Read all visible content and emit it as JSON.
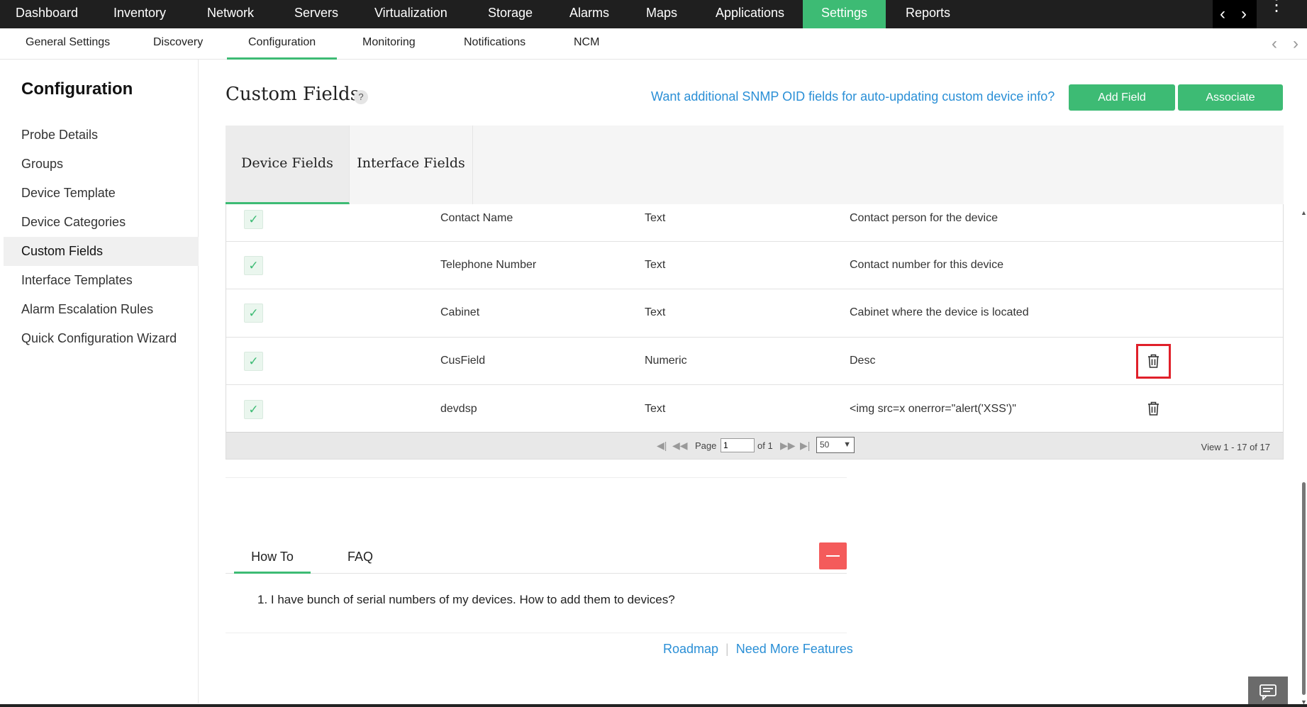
{
  "topnav": {
    "items": [
      {
        "label": "Dashboard"
      },
      {
        "label": "Inventory"
      },
      {
        "label": "Network"
      },
      {
        "label": "Servers"
      },
      {
        "label": "Virtualization"
      },
      {
        "label": "Storage"
      },
      {
        "label": "Alarms"
      },
      {
        "label": "Maps"
      },
      {
        "label": "Applications"
      },
      {
        "label": "Settings",
        "active": true
      },
      {
        "label": "Reports"
      }
    ]
  },
  "subnav": {
    "items": [
      {
        "label": "General Settings"
      },
      {
        "label": "Discovery"
      },
      {
        "label": "Configuration",
        "active": true
      },
      {
        "label": "Monitoring"
      },
      {
        "label": "Notifications"
      },
      {
        "label": "NCM"
      }
    ]
  },
  "sidebar": {
    "title": "Configuration",
    "items": [
      {
        "label": "Probe Details"
      },
      {
        "label": "Groups"
      },
      {
        "label": "Device Template"
      },
      {
        "label": "Device Categories"
      },
      {
        "label": "Custom Fields",
        "active": true
      },
      {
        "label": "Interface Templates"
      },
      {
        "label": "Alarm Escalation Rules"
      },
      {
        "label": "Quick Configuration Wizard"
      }
    ]
  },
  "main": {
    "title": "Custom Fields",
    "help_glyph": "?",
    "snmp_link": "Want additional SNMP OID fields for auto-updating custom device info?",
    "add_field_label": "Add Field",
    "associate_label": "Associate",
    "tabs": [
      {
        "label": "Device Fields",
        "active": true
      },
      {
        "label": "Interface Fields"
      }
    ]
  },
  "table": {
    "rows": [
      {
        "name": "Contact Name",
        "type": "Text",
        "description": "Contact person for the device",
        "checked": true,
        "deletable": false
      },
      {
        "name": "Telephone Number",
        "type": "Text",
        "description": "Contact number for this device",
        "checked": true,
        "deletable": false
      },
      {
        "name": "Cabinet",
        "type": "Text",
        "description": "Cabinet where the device is located",
        "checked": true,
        "deletable": false
      },
      {
        "name": "CusField",
        "type": "Numeric",
        "description": "Desc",
        "checked": true,
        "deletable": true,
        "highlighted": true
      },
      {
        "name": "devdsp",
        "type": "Text",
        "description": "<img src=x onerror=\"alert('XSS')\"",
        "checked": true,
        "deletable": true
      }
    ],
    "pager": {
      "page_label": "Page",
      "page_value": "1",
      "of_label": "of 1",
      "page_size": "50",
      "view_text": "View 1 - 17 of 17"
    }
  },
  "howto": {
    "tabs": [
      {
        "label": "How To",
        "active": true
      },
      {
        "label": "FAQ"
      }
    ],
    "question": "1. I have bunch of serial numbers of my devices. How to add them to devices?",
    "links": {
      "roadmap": "Roadmap",
      "features": "Need More Features"
    }
  },
  "colors": {
    "accent": "#3dbb74",
    "link": "#2a8fd6",
    "topnav_bg": "#1f1f1f",
    "danger": "#f45b5b",
    "highlight": "#e0202a"
  },
  "icons": {
    "nav_back": "chevron-left-icon",
    "nav_forward": "chevron-right-icon",
    "menu": "kebab-menu-icon",
    "check": "checkmark-icon",
    "delete": "trash-icon",
    "chat": "chat-icon"
  }
}
